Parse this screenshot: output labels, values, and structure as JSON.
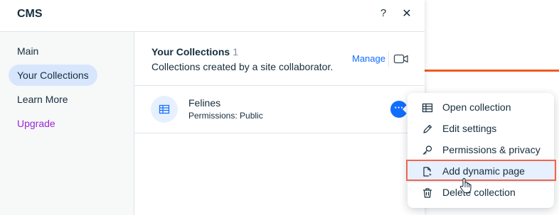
{
  "panel": {
    "title": "CMS"
  },
  "sidebar": {
    "items": [
      {
        "label": "Main"
      },
      {
        "label": "Your Collections"
      },
      {
        "label": "Learn More"
      },
      {
        "label": "Upgrade"
      }
    ]
  },
  "section": {
    "title": "Your Collections",
    "count": "1",
    "subtitle": "Collections created by a site collaborator.",
    "manage_label": "Manage"
  },
  "collection": {
    "name": "Felines",
    "permissions": "Permissions: Public"
  },
  "menu": {
    "items": [
      {
        "label": "Open collection",
        "icon": "table-icon"
      },
      {
        "label": "Edit settings",
        "icon": "pencil-icon"
      },
      {
        "label": "Permissions & privacy",
        "icon": "key-icon"
      },
      {
        "label": "Add dynamic page",
        "icon": "dynamic-page-icon"
      },
      {
        "label": "Delete collection",
        "icon": "trash-icon"
      }
    ]
  },
  "colors": {
    "accent": "#116dff",
    "active_nav_bg": "#d7e6fd",
    "upgrade": "#9a27d5",
    "highlight_border": "#f0654d",
    "background_line": "#f05a22"
  }
}
